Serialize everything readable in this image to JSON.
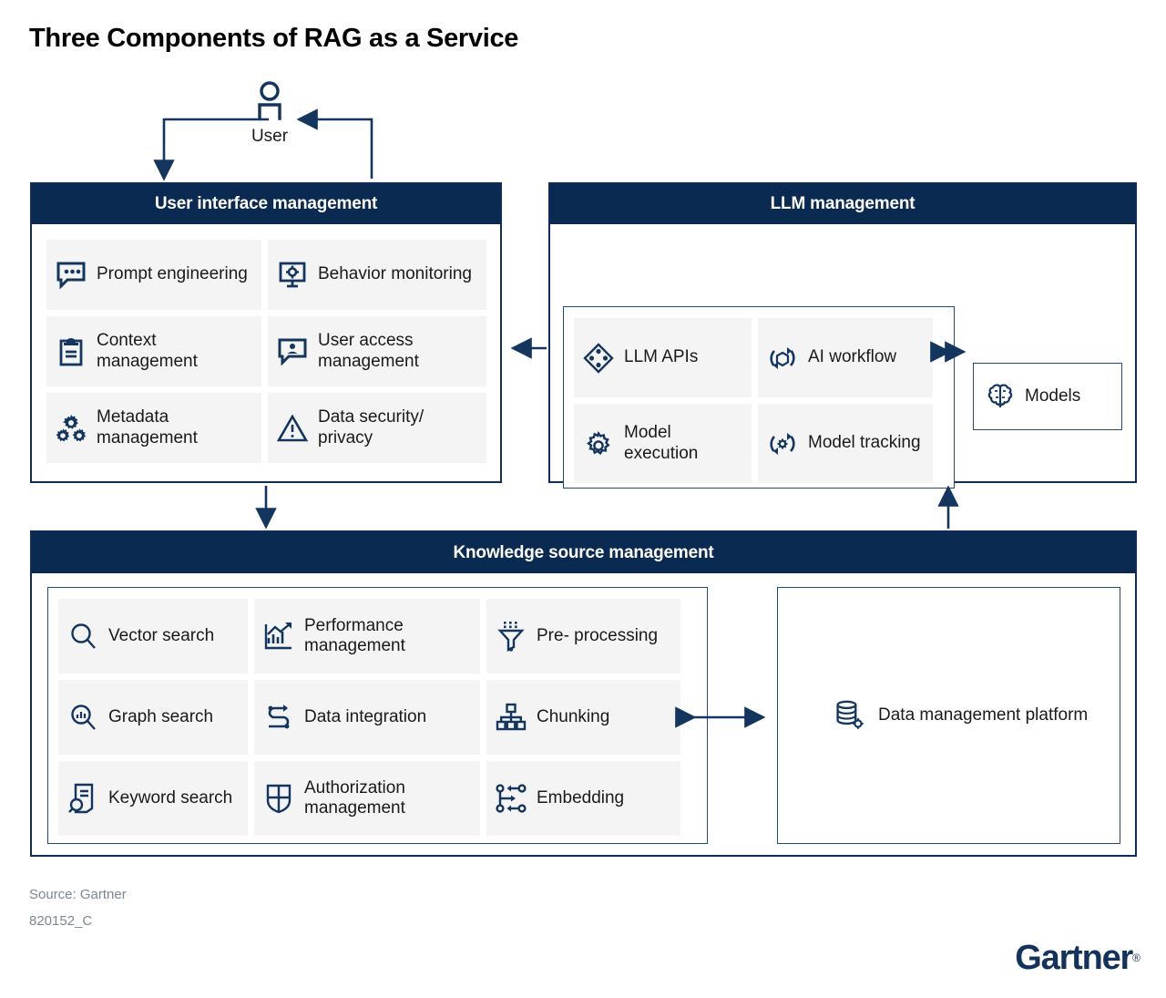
{
  "title": "Three Components of RAG as a Service",
  "user": {
    "label": "User",
    "icon": "user-person-icon"
  },
  "colors": {
    "header_navy": "#0b2a51",
    "border_navy": "#0f2d56",
    "tile_grey": "#f4f4f4",
    "arrow_navy": "#163a66",
    "source_grey": "#7b8794",
    "logo_navy": "#14335c"
  },
  "panels": {
    "user_interface": {
      "title": "User interface management",
      "tiles": [
        {
          "label": "Prompt engineering",
          "icon": "chat-dots-icon"
        },
        {
          "label": "Behavior monitoring",
          "icon": "monitor-gear-icon"
        },
        {
          "label": "Context management",
          "icon": "clipboard-icon"
        },
        {
          "label": "User access management",
          "icon": "chat-person-icon"
        },
        {
          "label": "Metadata management",
          "icon": "gears-icon"
        },
        {
          "label": "Data security/ privacy",
          "icon": "warning-triangle-icon"
        }
      ]
    },
    "llm": {
      "title": "LLM management",
      "tiles": [
        {
          "label": "LLM APIs",
          "icon": "diamond-nodes-icon"
        },
        {
          "label": "AI workflow",
          "icon": "cube-refresh-icon"
        },
        {
          "label": "Model execution",
          "icon": "gear-icon"
        },
        {
          "label": "Model tracking",
          "icon": "gear-refresh-icon"
        }
      ],
      "side_box": {
        "label": "Models",
        "icon": "brain-icon"
      }
    },
    "knowledge": {
      "title": "Knowledge source management",
      "tiles": [
        {
          "label": "Vector search",
          "icon": "magnifier-icon"
        },
        {
          "label": "Performance management",
          "icon": "bar-chart-trend-icon"
        },
        {
          "label": "Pre- processing",
          "icon": "funnel-filter-icon"
        },
        {
          "label": "Graph search",
          "icon": "magnifier-chart-icon"
        },
        {
          "label": "Data integration",
          "icon": "s-arrow-icon"
        },
        {
          "label": "Chunking",
          "icon": "hierarchy-icon"
        },
        {
          "label": "Keyword search",
          "icon": "document-magnifier-icon"
        },
        {
          "label": "Authorization management",
          "icon": "shield-grid-icon"
        },
        {
          "label": "Embedding",
          "icon": "nodes-arrows-icon"
        }
      ],
      "side_box": {
        "label": "Data management platform",
        "icon": "database-gear-icon"
      }
    }
  },
  "footer": {
    "source": "Source: Gartner",
    "doc_id": "820152_C",
    "logo": "Gartner",
    "logo_reg": "®"
  }
}
